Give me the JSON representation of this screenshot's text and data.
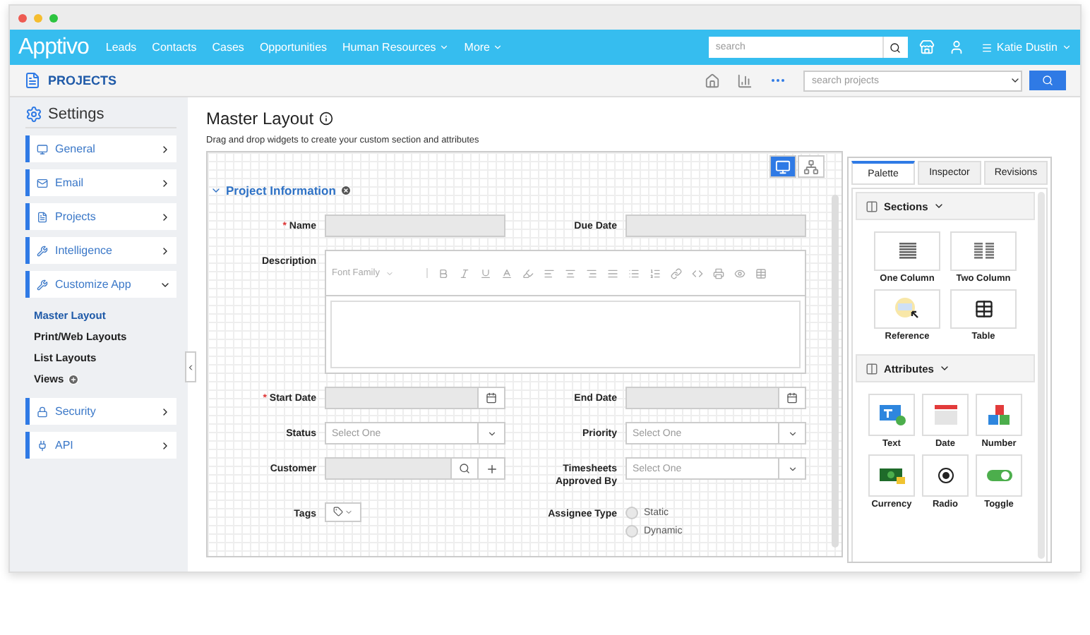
{
  "window_controls": [
    {
      "color": "#ee5b52"
    },
    {
      "color": "#f5bd2f"
    },
    {
      "color": "#2dc43f"
    }
  ],
  "nav": {
    "logo": "Apptivo",
    "links": [
      {
        "label": "Leads",
        "dropdown": false
      },
      {
        "label": "Contacts",
        "dropdown": false
      },
      {
        "label": "Cases",
        "dropdown": false
      },
      {
        "label": "Opportunities",
        "dropdown": false
      },
      {
        "label": "Human Resources",
        "dropdown": true
      },
      {
        "label": "More",
        "dropdown": true
      }
    ],
    "search": {
      "placeholder": "search"
    },
    "user": "Katie Dustin"
  },
  "header": {
    "title": "PROJECTS",
    "search": {
      "placeholder": "search projects"
    }
  },
  "sidebar": {
    "title": "Settings",
    "items": [
      {
        "label": "General",
        "kind": "general",
        "expanded": false
      },
      {
        "label": "Email",
        "kind": "email",
        "expanded": false
      },
      {
        "label": "Projects",
        "kind": "projects",
        "expanded": false
      },
      {
        "label": "Intelligence",
        "kind": "tools",
        "expanded": false
      },
      {
        "label": "Customize App",
        "kind": "tools",
        "expanded": true,
        "children": [
          {
            "label": "Master Layout",
            "selected": true,
            "add": false
          },
          {
            "label": "Print/Web Layouts",
            "selected": false,
            "add": false
          },
          {
            "label": "List Layouts",
            "selected": false,
            "add": false
          },
          {
            "label": "Views",
            "selected": false,
            "add": true
          }
        ]
      },
      {
        "label": "Security",
        "kind": "security",
        "expanded": false
      },
      {
        "label": "API",
        "kind": "api",
        "expanded": false
      }
    ]
  },
  "page": {
    "title": "Master Layout",
    "description": "Drag and drop widgets to create your custom section and attributes"
  },
  "views": [
    {
      "kind": "desktop",
      "selected": true
    },
    {
      "kind": "hierarchy",
      "selected": false
    }
  ],
  "section": {
    "title": "Project Information",
    "expanded": true
  },
  "required_marker": "*",
  "fields": [
    {
      "label": "Name",
      "kind": "text",
      "required": true
    },
    {
      "label": "Due Date",
      "kind": "text",
      "required": false
    },
    {
      "label": "Description",
      "kind": "editor",
      "required": false,
      "placeholder": "Font Family"
    },
    {
      "label": "Start Date",
      "kind": "date",
      "required": true
    },
    {
      "label": "End Date",
      "kind": "date",
      "required": false
    },
    {
      "label": "Status",
      "kind": "select",
      "required": false,
      "placeholder": "Select One"
    },
    {
      "label": "Priority",
      "kind": "select",
      "required": false,
      "placeholder": "Select One"
    },
    {
      "label": "Customer",
      "kind": "lookup",
      "required": false
    },
    {
      "label": "Timesheets Approved By",
      "kind": "select",
      "required": false,
      "placeholder": "Select One"
    },
    {
      "label": "Tags",
      "kind": "tags",
      "required": false
    },
    {
      "label": "Assignee Type",
      "kind": "radio",
      "required": false,
      "options": [
        {
          "label": "Static",
          "selected": false
        },
        {
          "label": "Dynamic",
          "selected": false
        }
      ]
    }
  ],
  "palette": {
    "tabs": [
      {
        "label": "Palette",
        "selected": true
      },
      {
        "label": "Inspector",
        "selected": false
      },
      {
        "label": "Revisions",
        "selected": false
      }
    ],
    "groups": [
      {
        "title": "Sections",
        "expanded": true,
        "items": [
          {
            "label": "One Column",
            "kind": "one-column"
          },
          {
            "label": "Two Column",
            "kind": "two-column"
          },
          {
            "label": "Reference",
            "kind": "reference"
          },
          {
            "label": "Table",
            "kind": "table"
          }
        ]
      },
      {
        "title": "Attributes",
        "expanded": true,
        "items": [
          {
            "label": "Text",
            "kind": "text"
          },
          {
            "label": "Date",
            "kind": "date"
          },
          {
            "label": "Number",
            "kind": "number"
          },
          {
            "label": "Currency",
            "kind": "currency"
          },
          {
            "label": "Radio",
            "kind": "radio"
          },
          {
            "label": "Toggle",
            "kind": "toggle"
          }
        ]
      }
    ]
  }
}
